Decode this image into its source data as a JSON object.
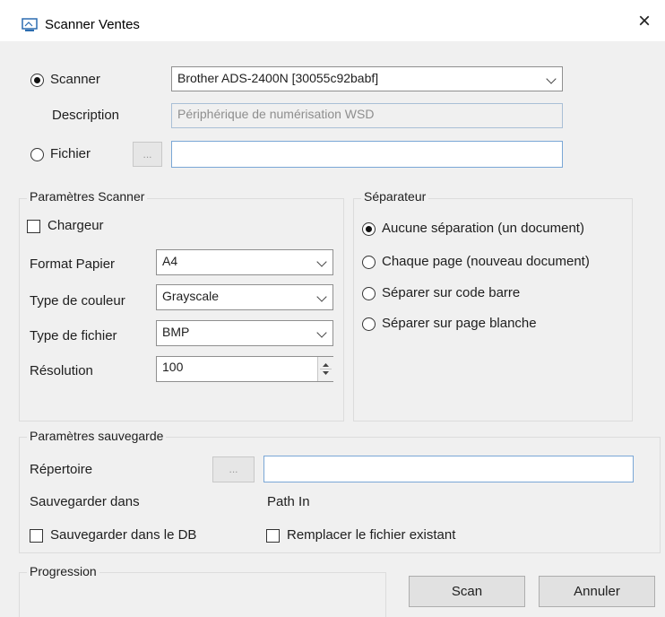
{
  "window": {
    "title": "Scanner Ventes",
    "close_icon": "×"
  },
  "source": {
    "scanner_label": "Scanner",
    "scanner_value": "Brother ADS-2400N [30055c92babf]",
    "description_label": "Description",
    "description_value": "Périphérique de numérisation WSD",
    "file_label": "Fichier",
    "file_browse_label": "...",
    "file_value": ""
  },
  "scanner_params": {
    "legend": "Paramètres Scanner",
    "feeder_label": "Chargeur",
    "paper_format_label": "Format Papier",
    "paper_format_value": "A4",
    "color_type_label": "Type de couleur",
    "color_type_value": "Grayscale",
    "file_type_label": "Type de fichier",
    "file_type_value": "BMP",
    "resolution_label": "Résolution",
    "resolution_value": "100"
  },
  "separator": {
    "legend": "Séparateur",
    "options": [
      "Aucune séparation (un document)",
      "Chaque page (nouveau document)",
      "Séparer sur code barre",
      "Séparer sur page blanche"
    ],
    "selected_index": 0
  },
  "save_params": {
    "legend": "Paramètres sauvegarde",
    "directory_label": "Répertoire",
    "directory_browse_label": "...",
    "directory_value": "",
    "save_in_label": "Sauvegarder dans",
    "save_in_value": "Path In",
    "save_db_label": "Sauvegarder dans le DB",
    "replace_label": "Remplacer le fichier existant"
  },
  "progress": {
    "legend": "Progression"
  },
  "actions": {
    "scan_label": "Scan",
    "cancel_label": "Annuler"
  },
  "colors": {
    "field_border": "#9aa6b3",
    "blue_border": "#7aa7d6",
    "window_bg": "#f0f0f0"
  }
}
